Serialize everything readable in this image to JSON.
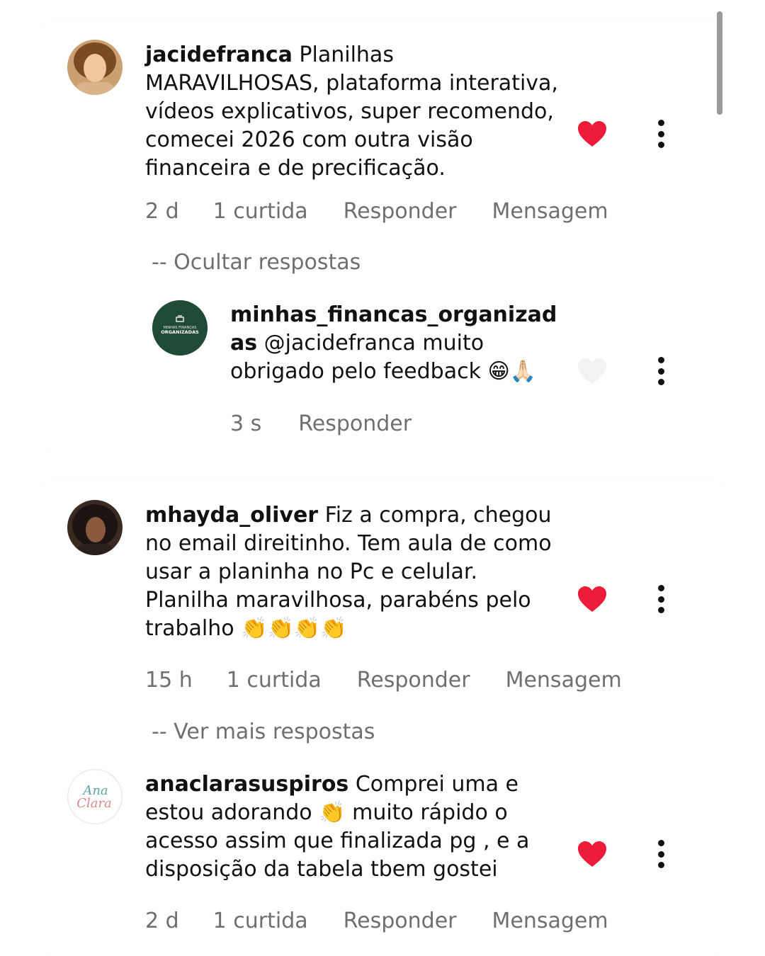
{
  "comments": [
    {
      "username": "jacidefranca",
      "text": " Planilhas MARAVILHOSAS, plataforma interativa, vídeos explicativos, super recomendo, comecei 2026 com outra visão financeira e de precificação.",
      "time": "2 d",
      "likes": "1 curtida",
      "reply_label": "Responder",
      "message_label": "Mensagem",
      "liked": true,
      "replies_toggle": "-- Ocultar respostas",
      "replies": [
        {
          "username": "minhas_financas_organizadas",
          "avatar_text_top": "MINHAS FINANÇAS",
          "avatar_text_bottom": "ORGANIZADAS",
          "text": " @jacidefranca muito obrigado pelo feedback 😁🙏🏻",
          "time": "3 s",
          "reply_label": "Responder",
          "liked": false
        }
      ]
    },
    {
      "username": "mhayda_oliver",
      "text": " Fiz a compra, chegou no email direitinho. Tem aula de como usar a planinha no Pc e celular. Planilha maravilhosa, parabéns pelo trabalho 👏👏👏👏",
      "time": "15 h",
      "likes": "1 curtida",
      "reply_label": "Responder",
      "message_label": "Mensagem",
      "liked": true,
      "replies_toggle": "-- Ver mais respostas"
    },
    {
      "username": "anaclarasuspiros",
      "avatar_text_top": "Ana",
      "avatar_text_bottom": "Clara",
      "text": " Comprei uma e estou adorando 👏 muito rápido o acesso assim que finalizada pg , e a disposição da tabela tbem gostei",
      "time": "2 d",
      "likes": "1 curtida",
      "reply_label": "Responder",
      "message_label": "Mensagem",
      "liked": true
    }
  ],
  "colors": {
    "heart_liked": "#ed1c3a",
    "heart_unliked": "#f2f2f2",
    "meta_text": "#6f6f6f",
    "brand_green": "#1f4a36"
  },
  "icons": [
    "heart-icon",
    "more-options-icon"
  ]
}
